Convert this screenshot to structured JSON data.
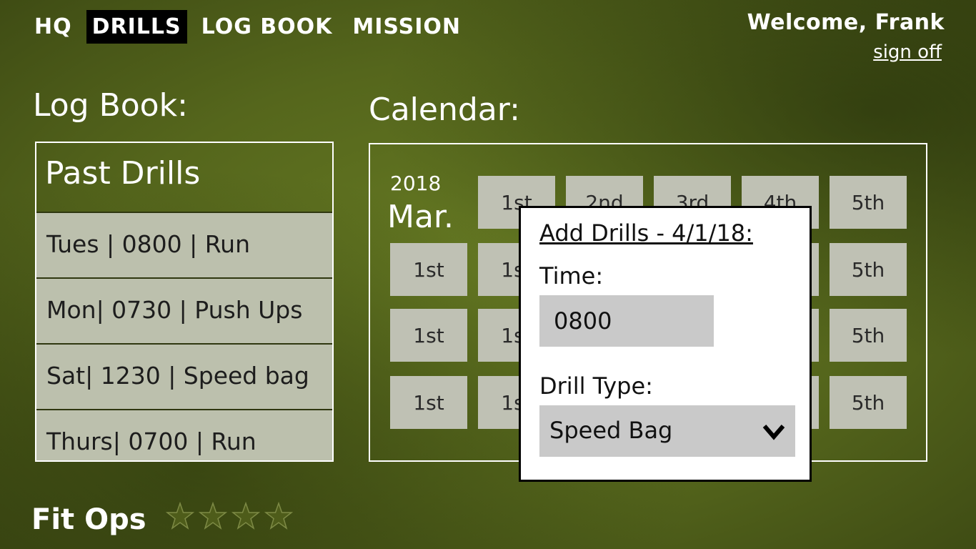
{
  "nav": {
    "items": [
      {
        "label": "HQ",
        "active": false
      },
      {
        "label": "DRILLS",
        "active": true
      },
      {
        "label": "LOG BOOK",
        "active": false
      },
      {
        "label": "MISSION",
        "active": false
      }
    ]
  },
  "user": {
    "welcome": "Welcome, Frank",
    "sign_off": "sign off"
  },
  "logbook": {
    "heading": "Log Book:",
    "panel_title": "Past Drills",
    "entries": [
      "Tues | 0800 | Run",
      "Mon| 0730 | Push Ups",
      "Sat| 1230 | Speed bag",
      "Thurs| 0700 | Run"
    ]
  },
  "calendar": {
    "heading": "Calendar:",
    "year": "2018",
    "month": "Mar.",
    "rows": [
      [
        "1st",
        "2nd",
        "3rd",
        "4th",
        "5th"
      ],
      [
        "1st",
        "1st",
        "",
        "",
        "5th"
      ],
      [
        "1st",
        "1st",
        "",
        "",
        "5th"
      ],
      [
        "1st",
        "1st",
        "",
        "",
        "5th"
      ]
    ]
  },
  "modal": {
    "title": "Add Drills - 4/1/18:",
    "time_label": "Time:",
    "time_value": "0800",
    "type_label": "Drill Type:",
    "type_value": "Speed Bag"
  },
  "footer": {
    "brand": "Fit Ops",
    "stars": 4
  },
  "colors": {
    "background": "#5a6b1f",
    "cell": "#bfc1b4",
    "row": "#bcc0ad",
    "input": "#c9c9c9"
  }
}
